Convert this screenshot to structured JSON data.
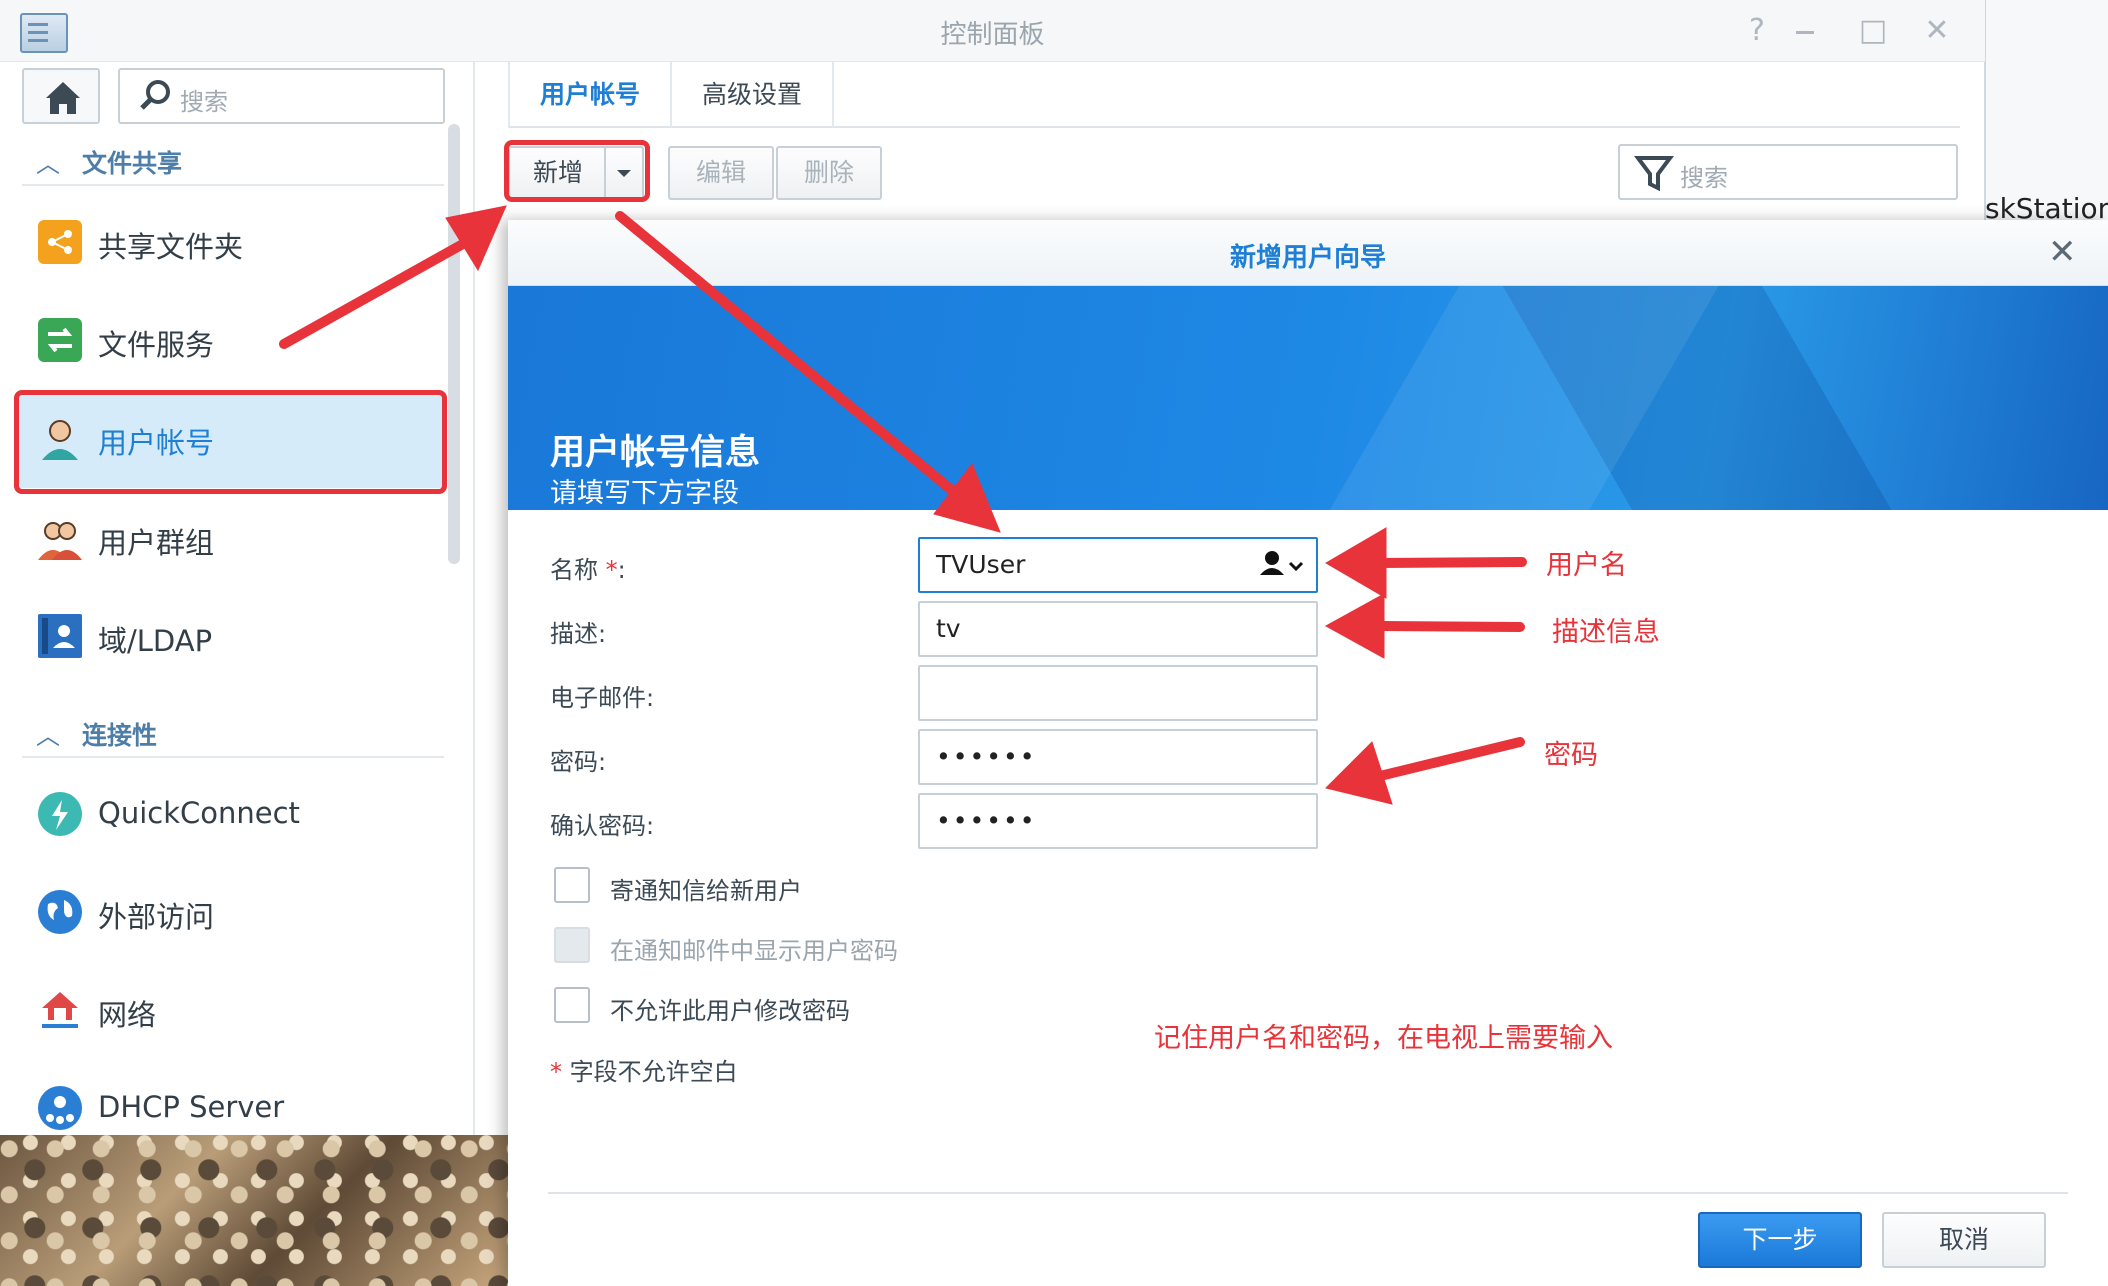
{
  "window": {
    "title": "控制面板",
    "help_glyph": "?",
    "maximize_glyph": "□",
    "close_glyph": "✕"
  },
  "background": {
    "right_partial_text": "skStation"
  },
  "sidebar": {
    "search_placeholder": "搜索",
    "sections": [
      {
        "label": "文件共享",
        "items": [
          {
            "label": "共享文件夹",
            "icon": "share-folder-icon",
            "color": "#f4a21d"
          },
          {
            "label": "文件服务",
            "icon": "file-services-icon",
            "color": "#3aa757"
          },
          {
            "label": "用户帐号",
            "icon": "user-icon",
            "color": "#2fa6a2",
            "selected": true
          },
          {
            "label": "用户群组",
            "icon": "user-group-icon",
            "color": "#e0643c"
          },
          {
            "label": "域/LDAP",
            "icon": "ldap-icon",
            "color": "#2a6fc0"
          }
        ]
      },
      {
        "label": "连接性",
        "items": [
          {
            "label": "QuickConnect",
            "icon": "quickconnect-icon",
            "color": "#3cb9b3"
          },
          {
            "label": "外部访问",
            "icon": "globe-icon",
            "color": "#2a7fd4"
          },
          {
            "label": "网络",
            "icon": "network-home-icon",
            "color": "#e04848"
          },
          {
            "label": "DHCP Server",
            "icon": "dhcp-icon",
            "color": "#2a7fd4"
          }
        ]
      }
    ]
  },
  "main": {
    "tabs": [
      {
        "label": "用户帐号",
        "active": true
      },
      {
        "label": "高级设置",
        "active": false
      }
    ],
    "toolbar": {
      "add": "新增",
      "edit": "编辑",
      "delete": "删除",
      "search_placeholder": "搜索"
    }
  },
  "dialog": {
    "title": "新增用户向导",
    "close_glyph": "✕",
    "banner_title": "用户帐号信息",
    "banner_subtitle": "请填写下方字段",
    "fields": {
      "name_label": "名称",
      "name_required": "*",
      "name_colon": ":",
      "name_value": "TVUser",
      "description_label": "描述:",
      "description_value": "tv",
      "email_label": "电子邮件:",
      "email_value": "",
      "password_label": "密码:",
      "password_value": "••••••",
      "confirm_label": "确认密码:",
      "confirm_value": "••••••"
    },
    "checkboxes": [
      {
        "label": "寄通知信给新用户",
        "checked": false,
        "disabled": false
      },
      {
        "label": "在通知邮件中显示用户密码",
        "checked": false,
        "disabled": true
      },
      {
        "label": "不允许此用户修改密码",
        "checked": false,
        "disabled": false
      }
    ],
    "required_note_star": "*",
    "required_note": "字段不允许空白",
    "buttons": {
      "next": "下一步",
      "cancel": "取消"
    }
  },
  "annotations": {
    "username": "用户名",
    "description": "描述信息",
    "password": "密码",
    "remember": "记住用户名和密码，在电视上需要输入",
    "color": "#e8333a"
  }
}
